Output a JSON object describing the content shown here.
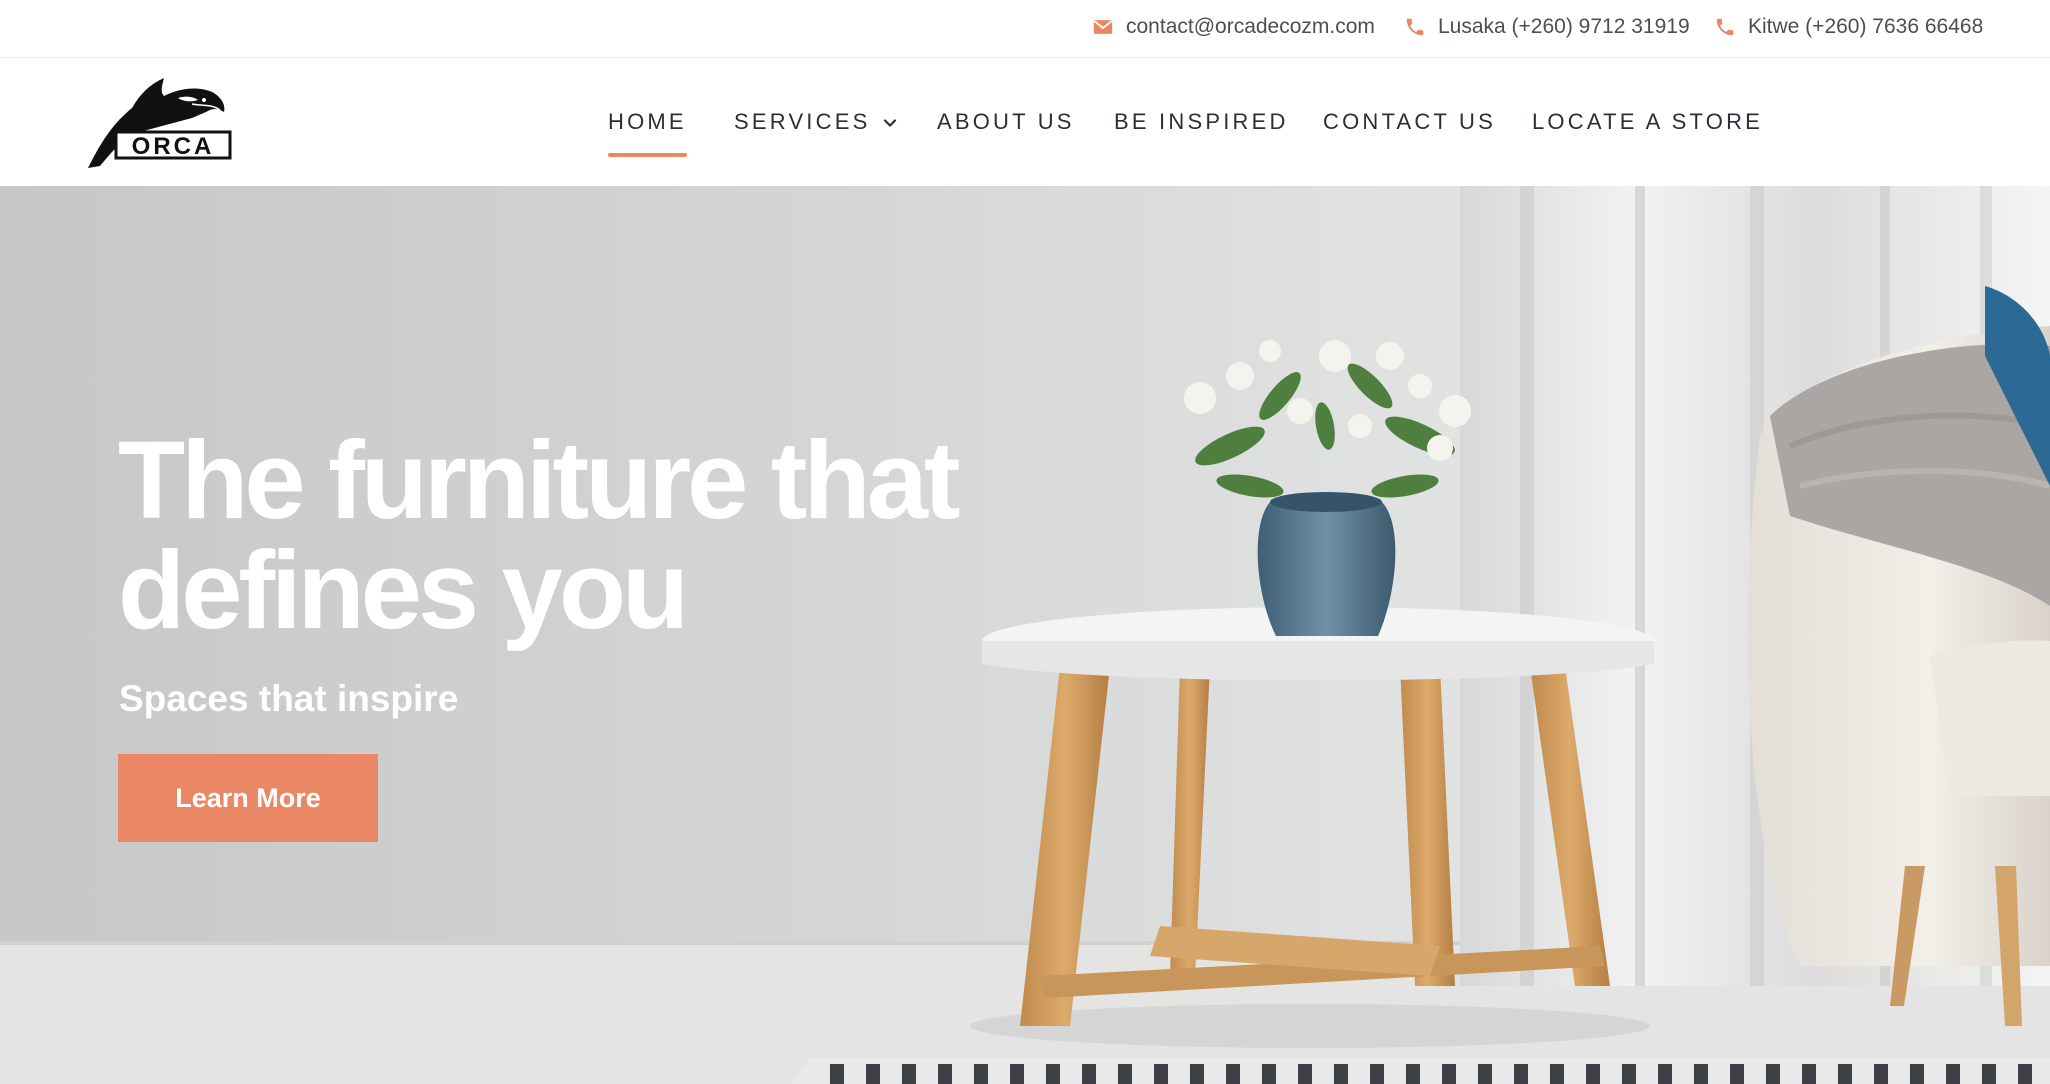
{
  "topbar": {
    "email": "contact@orcadecozm.com",
    "phone_lusaka": "Lusaka (+260) 9712 31919",
    "phone_kitwe": "Kitwe (+260) 7636 66468",
    "icons": {
      "email": "envelope-icon",
      "phone": "phone-icon"
    },
    "icon_color": "#ea8866"
  },
  "header": {
    "logo_text": "ORCA",
    "nav": {
      "home": "HOME",
      "services": "SERVICES",
      "about": "ABOUT US",
      "inspired": "BE INSPIRED",
      "contact": "CONTACT US",
      "locate": "LOCATE A STORE"
    },
    "active_item": "HOME"
  },
  "hero": {
    "title_line1": "The furniture that",
    "title_line2": "defines you",
    "subtitle": "Spaces that inspire",
    "cta_label": "Learn More"
  },
  "colors": {
    "accent": "#ea8866",
    "nav_text": "#2b2f3a",
    "hero_text": "#ffffff"
  }
}
